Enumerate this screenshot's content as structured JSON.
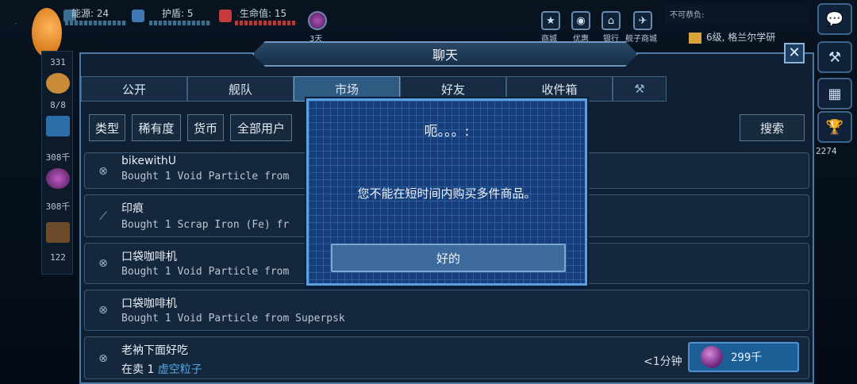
{
  "hud": {
    "energy_label": "能源: 24",
    "shield_label": "护盾: 5",
    "health_label": "生命值: 15",
    "day_label": "3天"
  },
  "top_nav": [
    {
      "label": "商城",
      "icon": "star-icon"
    },
    {
      "label": "优惠",
      "icon": "tag-icon"
    },
    {
      "label": "银行",
      "icon": "bank-icon"
    },
    {
      "label": "舰子商城",
      "icon": "ship-icon"
    }
  ],
  "notice": {
    "text": "不可恭负:"
  },
  "quest": {
    "text": "6级, 格兰尔学研"
  },
  "left_strip": {
    "values": [
      "331",
      "8/8",
      "308千",
      "308千",
      "122"
    ]
  },
  "right_sidebar": {
    "trophy_value": "2274"
  },
  "chat": {
    "title": "聊天",
    "tabs": [
      "公开",
      "舰队",
      "市场",
      "好友",
      "收件箱"
    ],
    "active_tab": "市场",
    "filters": [
      "类型",
      "稀有度",
      "货币",
      "全部用户"
    ],
    "search_label": "搜索",
    "messages": [
      {
        "user": "bikewithU",
        "text": "Bought 1 Void Particle from"
      },
      {
        "user": "印痕",
        "text": "Bought 1 Scrap Iron (Fe) fr"
      },
      {
        "user": "口袋咖啡机",
        "text": "Bought 1 Void Particle from"
      },
      {
        "user": "口袋咖啡机",
        "text": "Bought 1 Void Particle from Superpsk"
      },
      {
        "user": "老衲下面好吃",
        "text_prefix": "在卖 1",
        "item": "虚空粒子",
        "time": "<1分钟",
        "price": "299千"
      }
    ]
  },
  "dialog": {
    "title": "呃。。。:",
    "message": "您不能在短时间内购买多件商品。",
    "ok_label": "好的"
  },
  "colors": {
    "accent": "#5aa2df",
    "item_link": "#4aa8e6",
    "price_button": "#1c5f96"
  }
}
